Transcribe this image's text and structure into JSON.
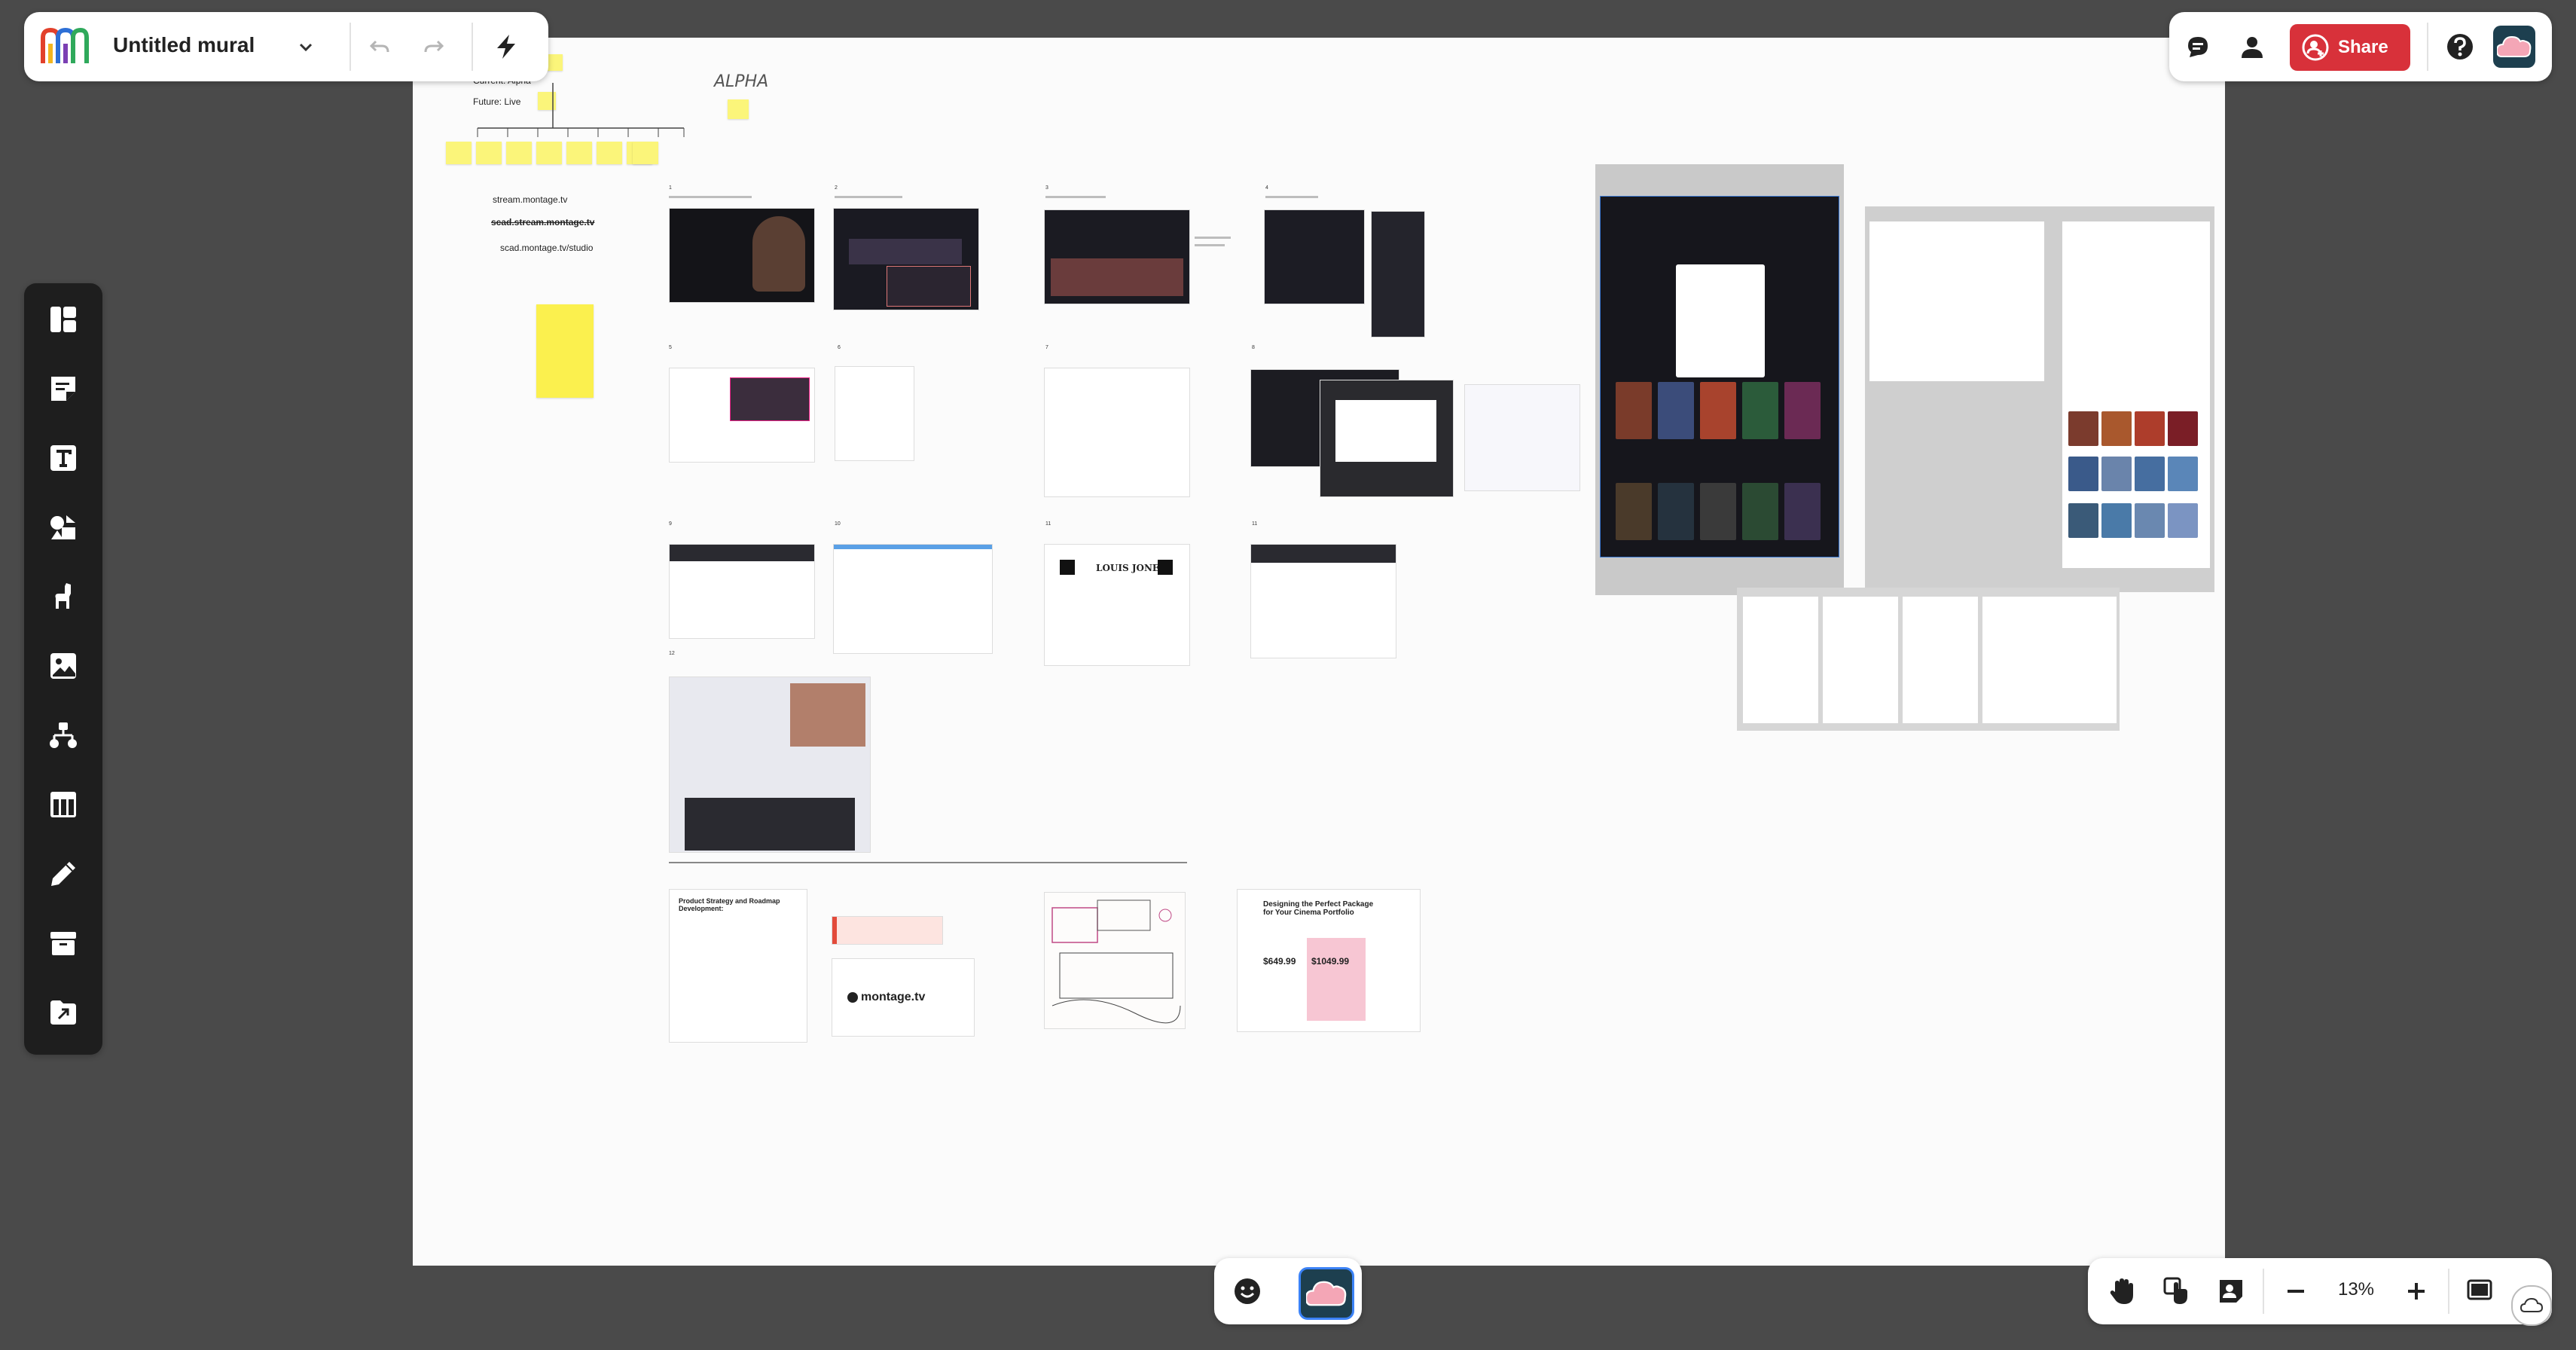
{
  "mural": {
    "title": "Untitled mural",
    "brand_colors": [
      "#e2402b",
      "#f3b61f",
      "#2fa95b",
      "#2d6fd6",
      "#7b3fb3"
    ]
  },
  "topbar": {
    "share_label": "Share",
    "share_color": "#d8313a"
  },
  "left_toolbar": {
    "items": [
      "templates-icon",
      "sticky-note-icon",
      "text-icon",
      "shapes-icon",
      "llama-icon",
      "image-icon",
      "diagram-icon",
      "table-icon",
      "pen-icon",
      "archive-icon",
      "import-icon"
    ]
  },
  "bottom_center": {
    "items": [
      "emoji-icon",
      "murally-icon"
    ]
  },
  "bottom_right": {
    "zoom": "13%",
    "zoom_value_percent": 13
  },
  "canvas": {
    "handwritten": "ALPHA",
    "urls": {
      "stream": "stream.montage.tv",
      "scad_strike": "scad.stream.montage.tv",
      "scad_studio": "scad.montage.tv/studio"
    },
    "org_chart": {
      "current_label": "Current: Alpha",
      "future_label": "Future:  Live"
    },
    "step_numbers": [
      "1",
      "2",
      "3",
      "4",
      "5",
      "6",
      "7",
      "8",
      "9",
      "10",
      "11",
      "11",
      "12"
    ],
    "roadmap_title": "Product Strategy and Roadmap Development:",
    "logo_text": "montage.tv",
    "pricing": {
      "title": "Designing the Perfect Package for Your Cinema Portfolio",
      "price_a": "$649.99",
      "price_b": "$1049.99"
    },
    "film_poster_title": "LOUIS JONES"
  }
}
